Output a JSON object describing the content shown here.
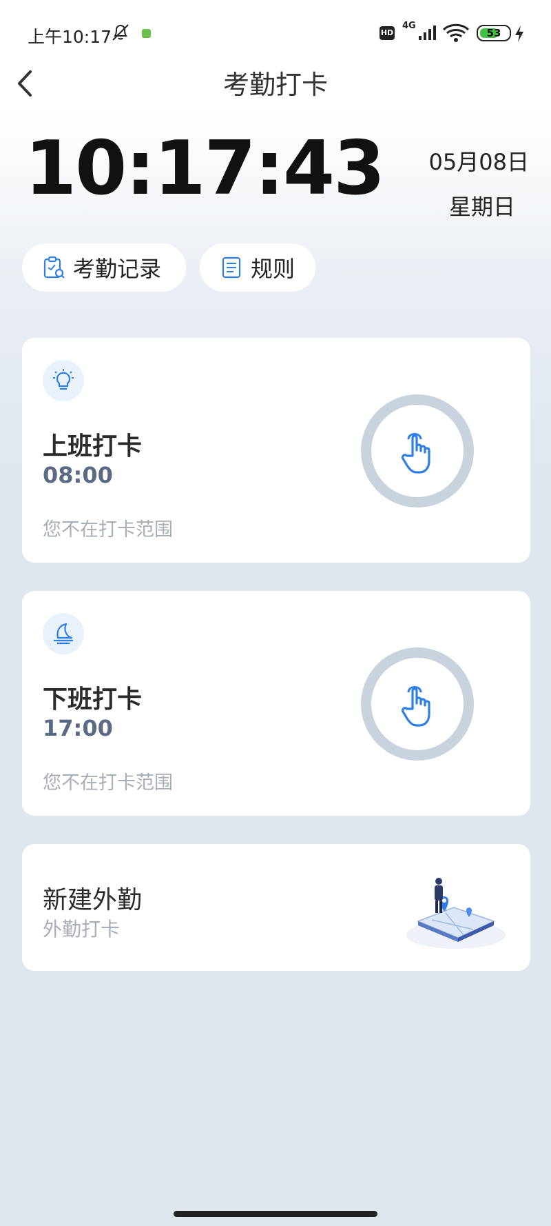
{
  "status_bar": {
    "time": "上午10:17",
    "network": "4G",
    "hd": "HD",
    "battery": "53"
  },
  "header": {
    "title": "考勤打卡"
  },
  "clock": {
    "time": "10:17:43",
    "date": "05月08日",
    "weekday": "星期日"
  },
  "quick_actions": {
    "records_label": "考勤记录",
    "rules_label": "规则"
  },
  "check_in": {
    "title": "上班打卡",
    "time": "08:00",
    "note": "您不在打卡范围"
  },
  "check_out": {
    "title": "下班打卡",
    "time": "17:00",
    "note": "您不在打卡范围"
  },
  "field_work": {
    "title": "新建外勤",
    "subtitle": "外勤打卡"
  },
  "colors": {
    "accent": "#2f7ee6",
    "ring": "#c8d3de",
    "time_text": "#5a6a85"
  }
}
